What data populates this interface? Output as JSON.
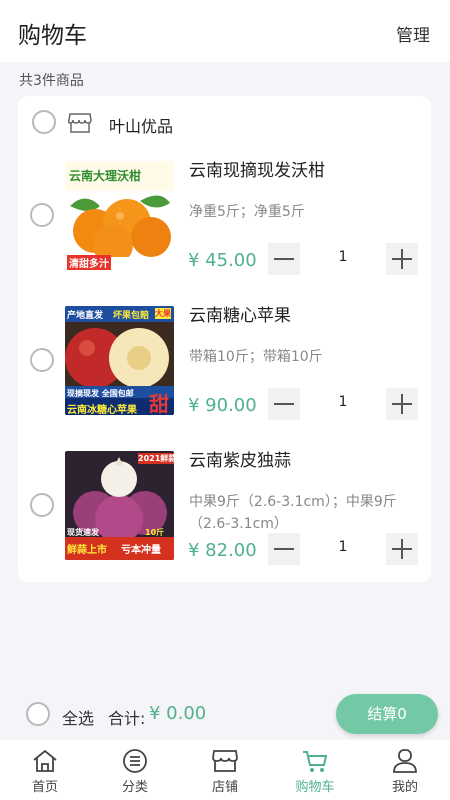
{
  "header": {
    "title": "购物车",
    "manage": "管理"
  },
  "summary": {
    "count_text": "共3件商品"
  },
  "store": {
    "name": "叶山优品",
    "icon": "store-icon"
  },
  "items": [
    {
      "name": "云南现摘现发沃柑",
      "spec": "净重5斤；净重5斤",
      "price": "¥ 45.00",
      "quantity": "1",
      "image_text_1": "云南大理沃柑",
      "image_text_2": "清甜多汁"
    },
    {
      "name": "云南糖心苹果",
      "spec": "带箱10斤；带箱10斤",
      "price": "¥ 90.00",
      "quantity": "1",
      "image_text_1": "产地直发",
      "image_text_2": "坏果包赔",
      "image_text_3": "大果",
      "image_text_4": "现摘现发 全国包邮",
      "image_text_5": "云南冰糖心苹果",
      "image_text_6": "甜"
    },
    {
      "name": "云南紫皮独蒜",
      "spec": "中果9斤（2.6-3.1cm）；中果9斤（2.6-3.1cm）",
      "price": "¥ 82.00",
      "quantity": "1",
      "image_text_1": "2021鲜蒜",
      "image_text_2": "现货速发",
      "image_text_3": "10斤",
      "image_text_4": "鲜蒜上市",
      "image_text_5": "亏本冲量"
    }
  ],
  "bottom": {
    "select_all": "全选",
    "total_label": "合计:",
    "total_value": "¥ 0.00",
    "checkout": "结算0"
  },
  "tabs": [
    {
      "label": "首页",
      "icon": "home-icon"
    },
    {
      "label": "分类",
      "icon": "category-icon"
    },
    {
      "label": "店铺",
      "icon": "shop-icon"
    },
    {
      "label": "购物车",
      "icon": "cart-icon",
      "active": true
    },
    {
      "label": "我的",
      "icon": "profile-icon"
    }
  ],
  "colors": {
    "accent": "#4fb28b",
    "checkout": "#73c8a5",
    "background": "#f5f4f8"
  }
}
